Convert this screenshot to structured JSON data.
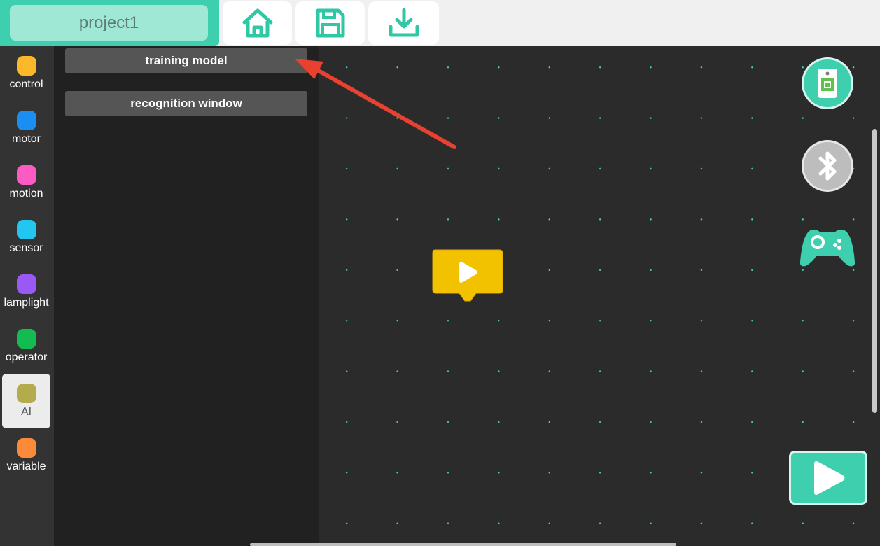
{
  "header": {
    "project_name": "project1",
    "toolbar": [
      {
        "name": "home-icon"
      },
      {
        "name": "save-icon"
      },
      {
        "name": "download-icon"
      }
    ]
  },
  "categories": [
    {
      "label": "control",
      "color": "#fbb82a"
    },
    {
      "label": "motor",
      "color": "#1a8ef2"
    },
    {
      "label": "motion",
      "color": "#fb5bc2"
    },
    {
      "label": "sensor",
      "color": "#22c6f0"
    },
    {
      "label": "lamplight",
      "color": "#9a58f5"
    },
    {
      "label": "operator",
      "color": "#13bb50"
    },
    {
      "label": "AI",
      "color": "#b4ab4c"
    },
    {
      "label": "variable",
      "color": "#fb8a3a"
    }
  ],
  "active_category": "AI",
  "palette": {
    "blocks": [
      {
        "label": "training model"
      },
      {
        "label": "recognition window"
      }
    ]
  },
  "workspace": {
    "start_block_icon": "play-icon",
    "side_icons": [
      "ai-board-icon",
      "bluetooth-icon",
      "gamepad-icon"
    ],
    "run_button_icon": "play-icon"
  },
  "colors": {
    "accent": "#3ecfae",
    "annotation_arrow": "#e8412f",
    "start_block": "#f2c100"
  }
}
